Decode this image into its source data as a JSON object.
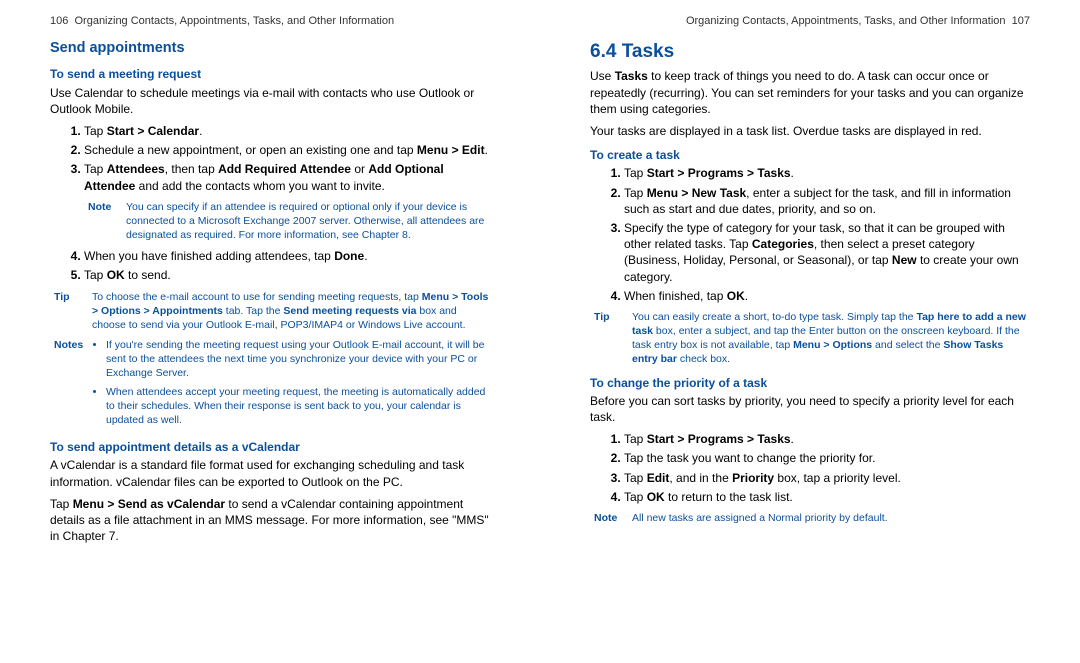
{
  "left": {
    "page_num": "106",
    "header_title": "Organizing Contacts, Appointments, Tasks, and Other Information",
    "h2_send": "Send appointments",
    "h3_meeting": "To send a meeting request",
    "p_meeting": "Use Calendar to schedule meetings via e-mail with contacts who use Outlook or Outlook Mobile.",
    "li1_a": "Tap ",
    "li1_b": "Start > Calendar",
    "li1_c": ".",
    "li2_a": "Schedule a new appointment, or open an existing one and tap ",
    "li2_b": "Menu > Edit",
    "li2_c": ".",
    "li3_a": "Tap ",
    "li3_b": "Attendees",
    "li3_c": ", then tap ",
    "li3_d": "Add Required Attendee",
    "li3_e": " or ",
    "li3_f": "Add Optional Attendee",
    "li3_g": " and add the contacts whom you want to invite.",
    "note1_label": "Note",
    "note1_body": "You can specify if an attendee is required or optional only if your device is connected to a Microsoft Exchange 2007 server. Otherwise, all attendees are designated as required. For more information, see Chapter 8.",
    "li4_a": "When you have finished adding attendees, tap ",
    "li4_b": "Done",
    "li4_c": ".",
    "li5_a": "Tap ",
    "li5_b": "OK",
    "li5_c": " to send.",
    "tip_label": "Tip",
    "tip_a": "To choose the e-mail account to use for sending meeting requests, tap ",
    "tip_b": "Menu > Tools > Options > Appointments",
    "tip_c": " tab. Tap the ",
    "tip_d": "Send meeting requests via",
    "tip_e": " box and choose to send via your Outlook E-mail, POP3/IMAP4 or Windows Live account.",
    "notes_label": "Notes",
    "notes_b1": "If you're sending the meeting request using your Outlook E-mail account, it will be sent to the attendees the next time you synchronize your device with your PC or Exchange Server.",
    "notes_b2": "When attendees accept your meeting request, the meeting is automatically added to their schedules. When their response is sent back to you, your calendar is updated as well.",
    "h3_vcal": "To send appointment details as a vCalendar",
    "p_vcal": "A vCalendar is a standard file format used for exchanging scheduling and task information. vCalendar files can be exported to Outlook on the PC.",
    "p_vcal2_a": "Tap ",
    "p_vcal2_b": "Menu > Send as vCalendar",
    "p_vcal2_c": " to send a vCalendar containing appointment details as a file attachment in an MMS message. For more information, see \"MMS\" in Chapter 7."
  },
  "right": {
    "page_num": "107",
    "header_title": "Organizing Contacts, Appointments, Tasks, and Other Information",
    "h1": "6.4  Tasks",
    "p1_a": "Use ",
    "p1_b": "Tasks",
    "p1_c": " to keep track of things you need to do. A task can occur once or repeatedly (recurring). You can set reminders for your tasks and you can organize them using categories.",
    "p2": "Your tasks are displayed in a task list. Overdue tasks are displayed in red.",
    "h3_create": "To create a task",
    "c1_a": "Tap ",
    "c1_b": "Start > Programs > Tasks",
    "c1_c": ".",
    "c2_a": "Tap ",
    "c2_b": "Menu > New Task",
    "c2_c": ", enter a subject for the task, and fill in information such as start and due dates, priority, and so on.",
    "c3_a": "Specify the type of category for your task, so that it can be grouped with other related tasks. Tap ",
    "c3_b": "Categories",
    "c3_c": ", then select a preset category (Business, Holiday, Personal, or Seasonal), or tap ",
    "c3_d": "New",
    "c3_e": " to create your own category.",
    "c4_a": "When finished, tap ",
    "c4_b": "OK",
    "c4_c": ".",
    "tip_label": "Tip",
    "tip_a": "You can easily create a short, to-do type task. Simply tap the ",
    "tip_b": "Tap here to add a new task",
    "tip_c": " box, enter a subject, and tap the Enter button on the onscreen keyboard. If the task entry box is not available, tap ",
    "tip_d": "Menu > Options",
    "tip_e": " and select the ",
    "tip_f": "Show Tasks entry bar",
    "tip_g": " check box.",
    "h3_pri": "To change the priority of a task",
    "p_pri": "Before you can sort tasks by priority, you need to specify a priority level for each task.",
    "pr1_a": "Tap ",
    "pr1_b": "Start > Programs > Tasks",
    "pr1_c": ".",
    "pr2": "Tap the task you want to change the priority for.",
    "pr3_a": "Tap ",
    "pr3_b": "Edit",
    "pr3_c": ", and in the ",
    "pr3_d": "Priority",
    "pr3_e": " box, tap a priority level.",
    "pr4_a": "Tap ",
    "pr4_b": "OK",
    "pr4_c": " to return to the task list.",
    "note_label": "Note",
    "note_body": "All new tasks are assigned a Normal priority by default."
  }
}
